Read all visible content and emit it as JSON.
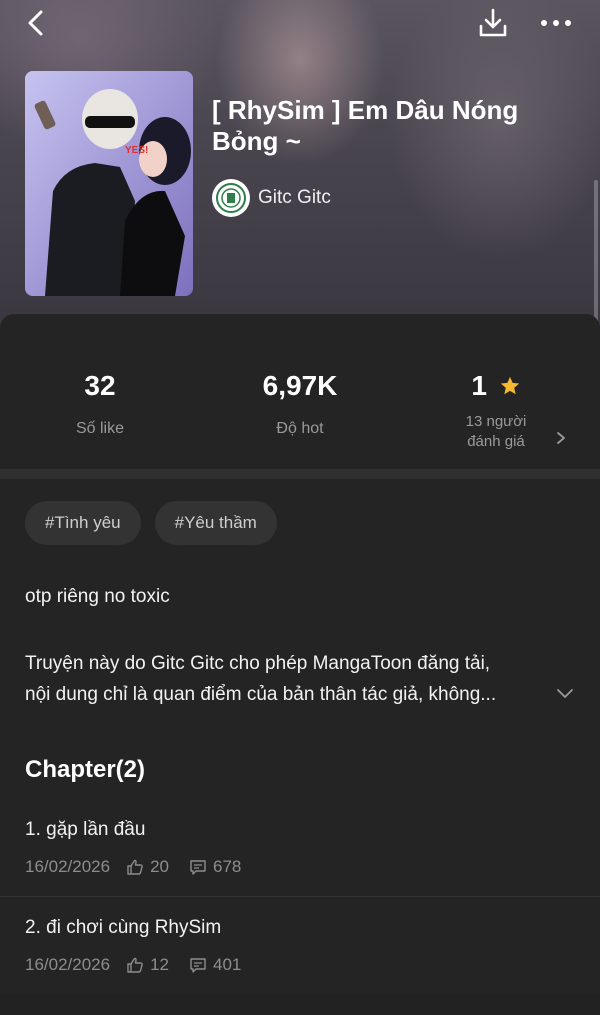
{
  "header": {
    "title": "[ RhySim ] Em Dâu Nóng Bỏng ~",
    "author": "Gitc Gitc"
  },
  "cover": {
    "sign_text": "YES!"
  },
  "stats": {
    "likes": {
      "value": "32",
      "label": "Số like"
    },
    "hot": {
      "value": "6,97K",
      "label": "Độ hot"
    },
    "rating": {
      "value": "1",
      "label_line1": "13 người",
      "label_line2": "đánh giá"
    }
  },
  "tags": [
    "#Tình yêu",
    "#Yêu thầm"
  ],
  "summary": "otp riêng no toxic",
  "description": {
    "line1": "Truyện này do Gitc Gitc cho phép MangaToon đăng tải,",
    "line2": "nội dung chỉ là quan điểm của bản thân tác giả, không..."
  },
  "chapters_heading": "Chapter(2)",
  "chapters": [
    {
      "title": "1. gặp lần đầu",
      "date": "16/02/2026",
      "likes": "20",
      "comments": "678"
    },
    {
      "title": "2. đi chơi cùng RhySim",
      "date": "16/02/2026",
      "likes": "12",
      "comments": "401"
    }
  ],
  "colors": {
    "star": "#F5B82E",
    "background": "#242424",
    "tag_bg": "#333333"
  },
  "icons": [
    "back-icon",
    "download-icon",
    "more-icon",
    "star-icon",
    "chevron-right-icon",
    "chevron-down-icon",
    "thumbs-up-icon",
    "comment-icon"
  ]
}
